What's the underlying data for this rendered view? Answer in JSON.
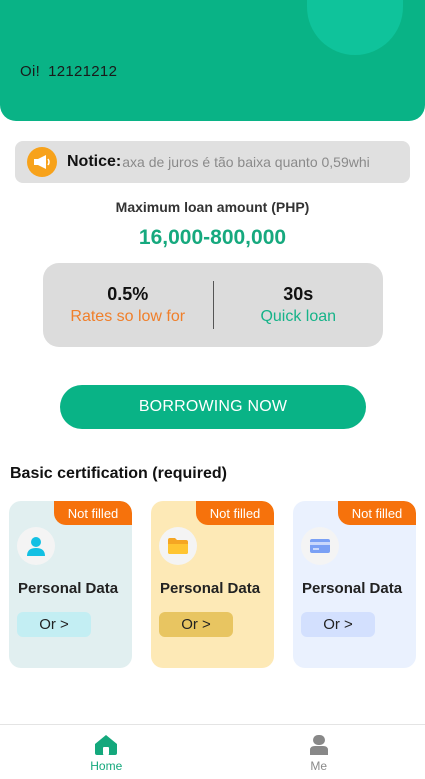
{
  "header": {
    "greeting": "Oi!",
    "user_id": "12121212",
    "colors": {
      "background": "#09b386",
      "decoration": "#0fc39b"
    }
  },
  "notice": {
    "icon": "megaphone-icon",
    "label": "Notice:",
    "text": "axa de juros é tão baixa quanto 0,59whi"
  },
  "loan": {
    "max_label": "Maximum loan amount (PHP)",
    "max_amount": "16,000-800,000"
  },
  "stats": [
    {
      "value": "0.5%",
      "label": "Rates so low for",
      "color": "#f07f2a"
    },
    {
      "value": "30s",
      "label": "Quick loan",
      "color": "#16b389"
    }
  ],
  "borrow_button": {
    "label": "BORROWING NOW"
  },
  "certification": {
    "title": "Basic certification (required)",
    "cards": [
      {
        "badge": "Not filled",
        "title": "Personal Data",
        "action": "Or >",
        "icon": "person-icon",
        "color": "#e1eff0"
      },
      {
        "badge": "Not filled",
        "title": "Personal Data",
        "action": "Or >",
        "icon": "folder-icon",
        "color": "#fde9b6"
      },
      {
        "badge": "Not filled",
        "title": "Personal Data",
        "action": "Or >",
        "icon": "credit-card-icon",
        "color": "#eaf1fe"
      }
    ]
  },
  "tabbar": {
    "items": [
      {
        "label": "Home",
        "icon": "home-icon",
        "active": true
      },
      {
        "label": "Me",
        "icon": "user-icon",
        "active": false
      }
    ]
  }
}
